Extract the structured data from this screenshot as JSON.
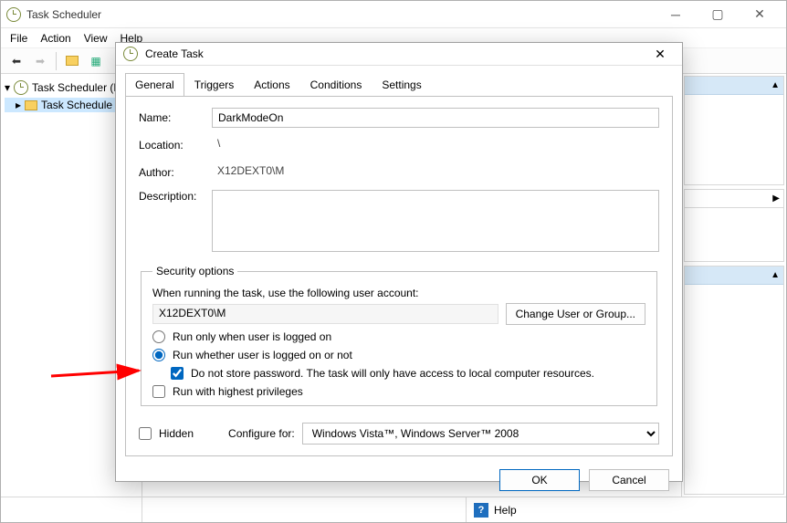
{
  "window": {
    "title": "Task Scheduler",
    "menu": {
      "file": "File",
      "action": "Action",
      "view": "View",
      "help": "Help"
    }
  },
  "tree": {
    "root": "Task Scheduler (L",
    "child": "Task Schedule"
  },
  "status": {
    "help": "Help"
  },
  "dialog": {
    "title": "Create Task",
    "tabs": {
      "general": "General",
      "triggers": "Triggers",
      "actions": "Actions",
      "conditions": "Conditions",
      "settings": "Settings"
    },
    "labels": {
      "name": "Name:",
      "location": "Location:",
      "author": "Author:",
      "description": "Description:",
      "security_legend": "Security options",
      "security_text": "When running the task, use the following user account:",
      "change_user": "Change User or Group...",
      "run_logged_on": "Run only when user is logged on",
      "run_whether": "Run whether user is logged on or not",
      "no_store_pw": "Do not store password.  The task will only have access to local computer resources.",
      "highest_priv": "Run with highest privileges",
      "hidden": "Hidden",
      "configure_for": "Configure for:"
    },
    "values": {
      "name": "DarkModeOn",
      "location": "\\",
      "author": "X12DEXT0\\M",
      "description": "",
      "user_account": "X12DEXT0\\M",
      "configure_for": "Windows Vista™, Windows Server™ 2008",
      "run_logged_on": false,
      "run_whether": true,
      "no_store_pw": true,
      "highest_priv": false,
      "hidden": false
    },
    "buttons": {
      "ok": "OK",
      "cancel": "Cancel"
    }
  }
}
